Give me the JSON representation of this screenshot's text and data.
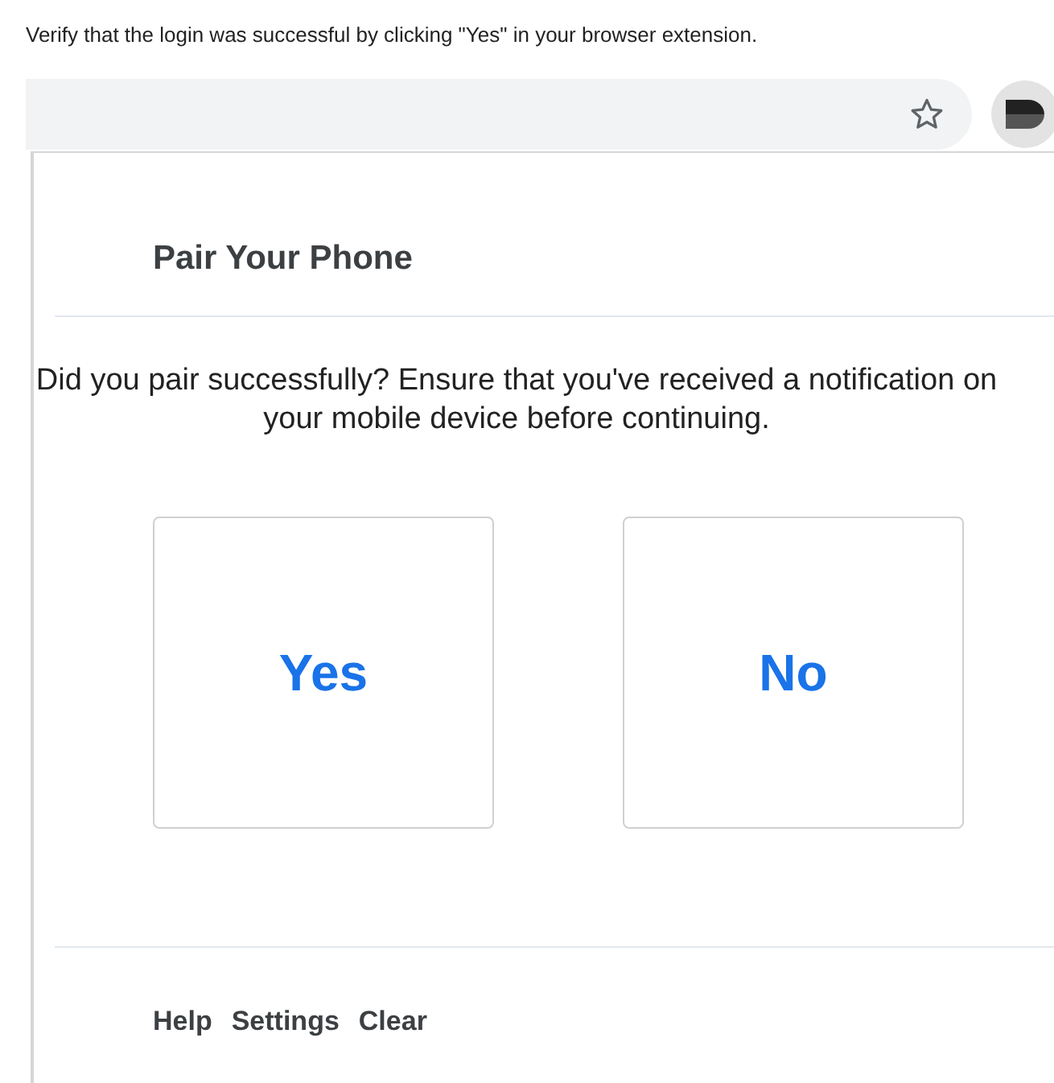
{
  "instruction": "Verify that the login was successful by clicking \"Yes\" in your browser extension.",
  "popup": {
    "title": "Pair Your Phone",
    "question": "Did you pair successfully? Ensure that you've received a notification on your mobile device before continuing.",
    "choices": [
      {
        "label": "Yes"
      },
      {
        "label": "No"
      }
    ],
    "footer_links": [
      "Help",
      "Settings",
      "Clear"
    ]
  }
}
